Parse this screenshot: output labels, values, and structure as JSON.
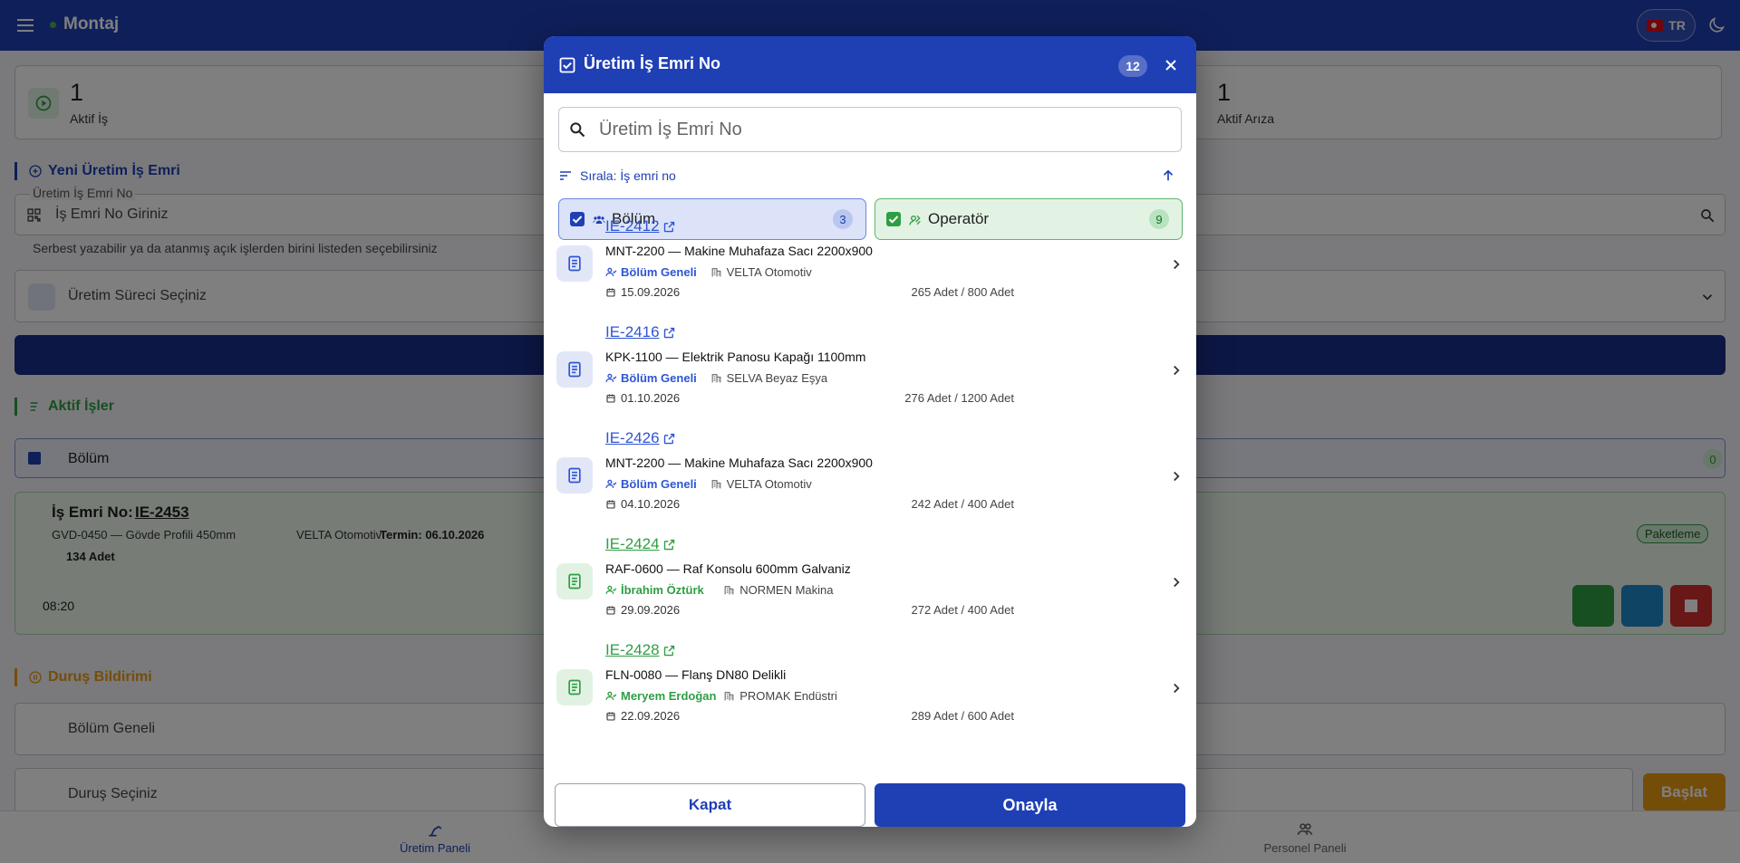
{
  "app": {
    "title": "Montaj",
    "lang": "TR"
  },
  "stats": {
    "active_jobs": {
      "value": "1",
      "label": "Aktif İş"
    },
    "active_faults": {
      "value": "1",
      "label": "Aktif Arıza"
    }
  },
  "new_order": {
    "heading": "Yeni Üretim İş Emri",
    "field_label": "Üretim İş Emri No",
    "field_placeholder": "İş Emri No Giriniz",
    "hint": "Serbest yazabilir ya da atanmış açık işlerden birini listeden seçebilirsiniz",
    "process_placeholder": "Üretim Süreci Seçiniz"
  },
  "active_jobs_section": {
    "heading": "Aktif İşler",
    "filter_label": "Bölüm",
    "filter_count": "0",
    "job": {
      "prefix": "İş Emri No:",
      "id": "IE-2453",
      "product": "GVD-0450 — Gövde Profili 450mm",
      "customer": "VELTA Otomotiv",
      "deadline": "Termin: 06.10.2026",
      "qty": "134 Adet",
      "time": "08:20",
      "badge": "Paketleme"
    }
  },
  "downtime": {
    "heading": "Duruş Bildirimi",
    "scope_value": "Bölüm Geneli",
    "reason_placeholder": "Duruş Seçiniz",
    "start_label": "Başlat"
  },
  "bottom_nav": {
    "production": "Üretim Paneli",
    "personnel": "Personel Paneli"
  },
  "modal": {
    "title": "Üretim İş Emri No",
    "count": "12",
    "search_placeholder": "Üretim İş Emri No",
    "sort_label": "Sırala: İş emri no",
    "filters": {
      "dept": {
        "label": "Bölüm",
        "count": "3"
      },
      "operator": {
        "label": "Operatör",
        "count": "9"
      }
    },
    "items": [
      {
        "id": "IE-2412",
        "title": "MNT-2200 — Makine Muhafaza Sacı 2200x900",
        "assignee": "Bölüm Geneli",
        "customer": "VELTA Otomotiv",
        "date": "15.09.2026",
        "qty": "265 Adet / 800 Adet",
        "kind": "dept"
      },
      {
        "id": "IE-2416",
        "title": "KPK-1100 — Elektrik Panosu Kapağı 1100mm",
        "assignee": "Bölüm Geneli",
        "customer": "SELVA Beyaz Eşya",
        "date": "01.10.2026",
        "qty": "276 Adet / 1200 Adet",
        "kind": "dept"
      },
      {
        "id": "IE-2426",
        "title": "MNT-2200 — Makine Muhafaza Sacı 2200x900",
        "assignee": "Bölüm Geneli",
        "customer": "VELTA Otomotiv",
        "date": "04.10.2026",
        "qty": "242 Adet / 400 Adet",
        "kind": "dept"
      },
      {
        "id": "IE-2424",
        "title": "RAF-0600 — Raf Konsolu 600mm Galvaniz",
        "assignee": "İbrahim Öztürk",
        "customer": "NORMEN Makina",
        "date": "29.09.2026",
        "qty": "272 Adet / 400 Adet",
        "kind": "operator"
      },
      {
        "id": "IE-2428",
        "title": "FLN-0080 — Flanş DN80 Delikli",
        "assignee": "Meryem Erdoğan",
        "customer": "PROMAK Endüstri",
        "date": "22.09.2026",
        "qty": "289 Adet / 600 Adet",
        "kind": "operator"
      }
    ],
    "close_label": "Kapat",
    "confirm_label": "Onayla"
  },
  "colors": {
    "brand": "#1f3fb5",
    "dept": "#2f55d4",
    "operator": "#2e9e43",
    "warning": "#e89a13",
    "danger": "#d32f2f"
  }
}
